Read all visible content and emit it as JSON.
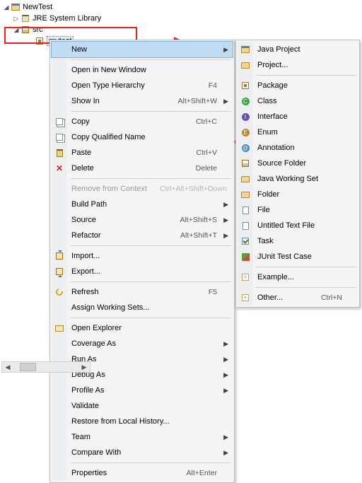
{
  "tree": {
    "project": "NewTest",
    "jre": "JRE System Library",
    "src": "src",
    "selected": "mytest"
  },
  "menu": {
    "new": "New",
    "open_new_window": "Open in New Window",
    "open_type_hierarchy": "Open Type Hierarchy",
    "open_type_hierarchy_key": "F4",
    "show_in": "Show In",
    "show_in_key": "Alt+Shift+W",
    "copy": "Copy",
    "copy_key": "Ctrl+C",
    "copy_qualified": "Copy Qualified Name",
    "paste": "Paste",
    "paste_key": "Ctrl+V",
    "delete": "Delete",
    "delete_key": "Delete",
    "remove_context": "Remove from Context",
    "remove_context_key": "Ctrl+Alt+Shift+Down",
    "build_path": "Build Path",
    "source": "Source",
    "source_key": "Alt+Shift+S",
    "refactor": "Refactor",
    "refactor_key": "Alt+Shift+T",
    "import": "Import...",
    "export": "Export...",
    "refresh": "Refresh",
    "refresh_key": "F5",
    "assign_ws": "Assign Working Sets...",
    "open_explorer": "Open Explorer",
    "coverage_as": "Coverage As",
    "run_as": "Run As",
    "debug_as": "Debug As",
    "profile_as": "Profile As",
    "validate": "Validate",
    "restore": "Restore from Local History...",
    "team": "Team",
    "compare": "Compare With",
    "properties": "Properties",
    "properties_key": "Alt+Enter"
  },
  "submenu": {
    "java_project": "Java Project",
    "project": "Project...",
    "package": "Package",
    "class": "Class",
    "interface": "Interface",
    "enum": "Enum",
    "annotation": "Annotation",
    "source_folder": "Source Folder",
    "java_ws": "Java Working Set",
    "folder": "Folder",
    "file": "File",
    "untitled": "Untitled Text File",
    "task": "Task",
    "junit": "JUnit Test Case",
    "example": "Example...",
    "other": "Other...",
    "other_key": "Ctrl+N"
  }
}
